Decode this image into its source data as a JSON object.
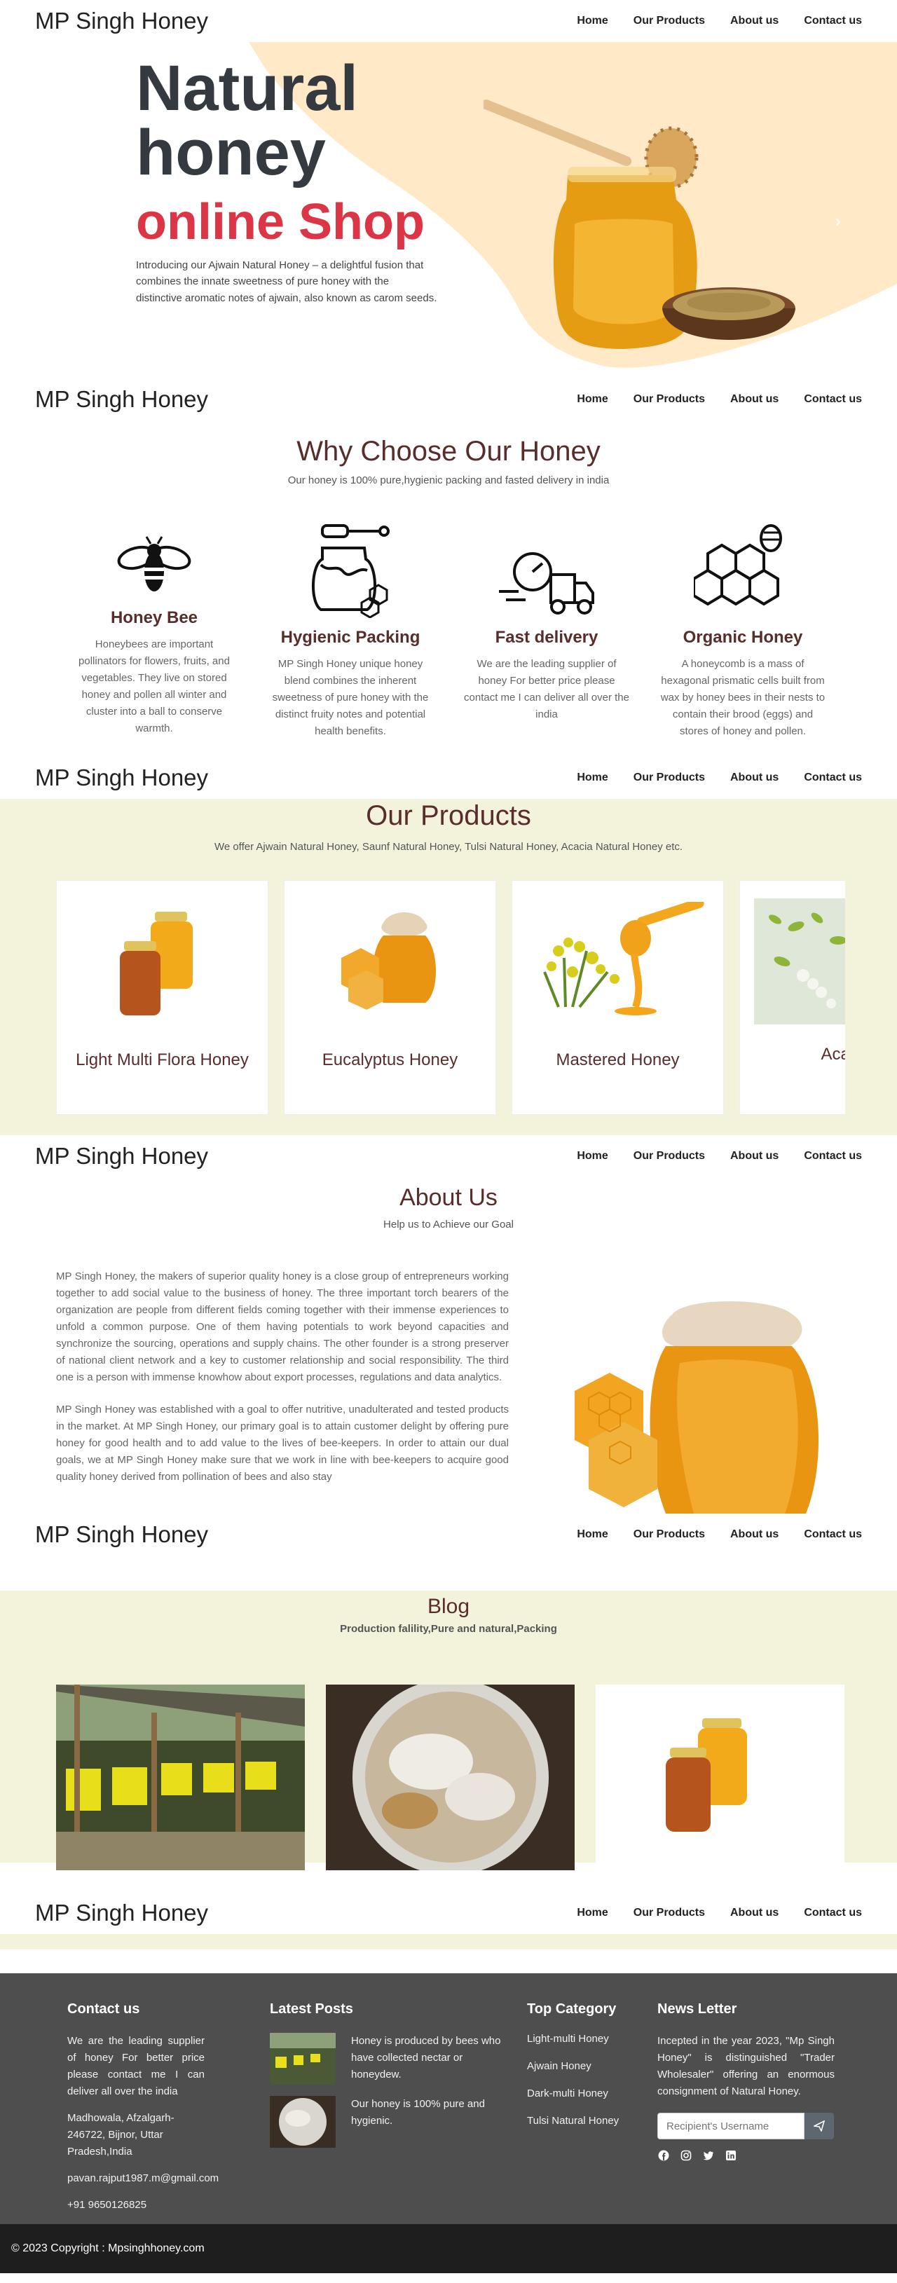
{
  "brand": "MP Singh Honey",
  "nav": [
    "Home",
    "Our Products",
    "About us",
    "Contact us"
  ],
  "hero": {
    "title_line1": "Natural",
    "title_line2": "honey",
    "title_line3": "online Shop",
    "description": "Introducing our Ajwain Natural Honey – a delightful fusion that combines the innate sweetness of pure honey with the distinctive aromatic notes of ajwain, also known as carom seeds.",
    "prev_icon": "chevron-left",
    "next_icon": "chevron-right"
  },
  "why": {
    "title": "Why Choose Our Honey",
    "subtitle": "Our honey is 100% pure,hygienic packing and fasted delivery in india",
    "features": [
      {
        "icon": "bee-icon",
        "title": "Honey Bee",
        "text": "Honeybees are important pollinators for flowers, fruits, and vegetables. They live on stored honey and pollen all winter and cluster into a ball to conserve warmth."
      },
      {
        "icon": "honey-jar-icon",
        "title": "Hygienic Packing",
        "text": "MP Singh Honey unique honey blend combines the inherent sweetness of pure honey with the distinct fruity notes and potential health benefits."
      },
      {
        "icon": "delivery-truck-icon",
        "title": "Fast delivery",
        "text": "We are the leading supplier of honey For better price please contact me I can deliver all over the india"
      },
      {
        "icon": "honeycomb-icon",
        "title": "Organic Honey",
        "text": "A honeycomb is a mass of hexagonal prismatic cells built from wax by honey bees in their nests to contain their brood (eggs) and stores of honey and pollen."
      }
    ]
  },
  "products": {
    "title": "Our Products",
    "subtitle": "We offer Ajwain Natural Honey, Saunf Natural Honey, Tulsi Natural Honey, Acacia Natural Honey etc.",
    "items": [
      {
        "name": "Light Multi Flora Honey"
      },
      {
        "name": "Eucalyptus Honey"
      },
      {
        "name": "Mastered Honey"
      },
      {
        "name": "Acacia"
      }
    ]
  },
  "about": {
    "title": "About Us",
    "subtitle": "Help us to Achieve our Goal",
    "para1": "MP Singh Honey, the makers of superior quality honey is a close group of entrepreneurs working together to add social value to the business of honey. The three important torch bearers of the organization are people from different fields coming together with their immense experiences to unfold a common purpose. One of them having potentials to work beyond capacities and synchronize the sourcing, operations and supply chains. The other founder is a strong preserver of national client network and a key to customer relationship and social responsibility. The third one is a person with immense knowhow about export processes, regulations and data analytics.",
    "para2": "MP Singh Honey was established with a goal to offer nutritive, unadulterated and tested products in the market. At MP Singh Honey, our primary goal is to attain customer delight by offering pure honey for good health and to add value to the lives of bee-keepers. In order to attain our dual goals, we at MP Singh Honey make sure that we work in line with bee-keepers to acquire good quality honey derived from pollination of bees and also stay"
  },
  "blog": {
    "title": "Blog",
    "subtitle": "Production falility,Pure and natural,Packing"
  },
  "footer": {
    "contact": {
      "heading": "Contact us",
      "text": "We are the leading supplier of honey For better price please contact me I can deliver all over the india",
      "address": "Madhowala, Afzalgarh-246722, Bijnor, Uttar Pradesh,India",
      "email": "pavan.rajput1987.m@gmail.com",
      "phone": "+91 9650126825"
    },
    "latest_posts": {
      "heading": "Latest Posts",
      "posts": [
        {
          "text": "Honey is produced by bees who have collected nectar or honeydew."
        },
        {
          "text": "Our honey is 100% pure and hygienic."
        }
      ]
    },
    "top_category": {
      "heading": "Top Category",
      "items": [
        "Light-multi Honey",
        "Ajwain Honey",
        "Dark-multi Honey",
        "Tulsi Natural Honey"
      ]
    },
    "newsletter": {
      "heading": "News Letter",
      "text": "Incepted in the year 2023, \"Mp Singh Honey\" is distinguished \"Trader Wholesaler\" offering an enormous consignment of Natural Honey.",
      "placeholder": "Recipient's Username",
      "social_icons": [
        "facebook-icon",
        "instagram-icon",
        "twitter-icon",
        "linkedin-icon"
      ]
    },
    "copyright": "© 2023 Copyright : Mpsinghhoney.com"
  },
  "colors": {
    "accent_red": "#dc3545",
    "heading_brown": "#5a2d2d",
    "cream_band": "#f3f3dc",
    "hero_blob": "#ffe9c7",
    "footer_bg": "#4f4e4e"
  }
}
